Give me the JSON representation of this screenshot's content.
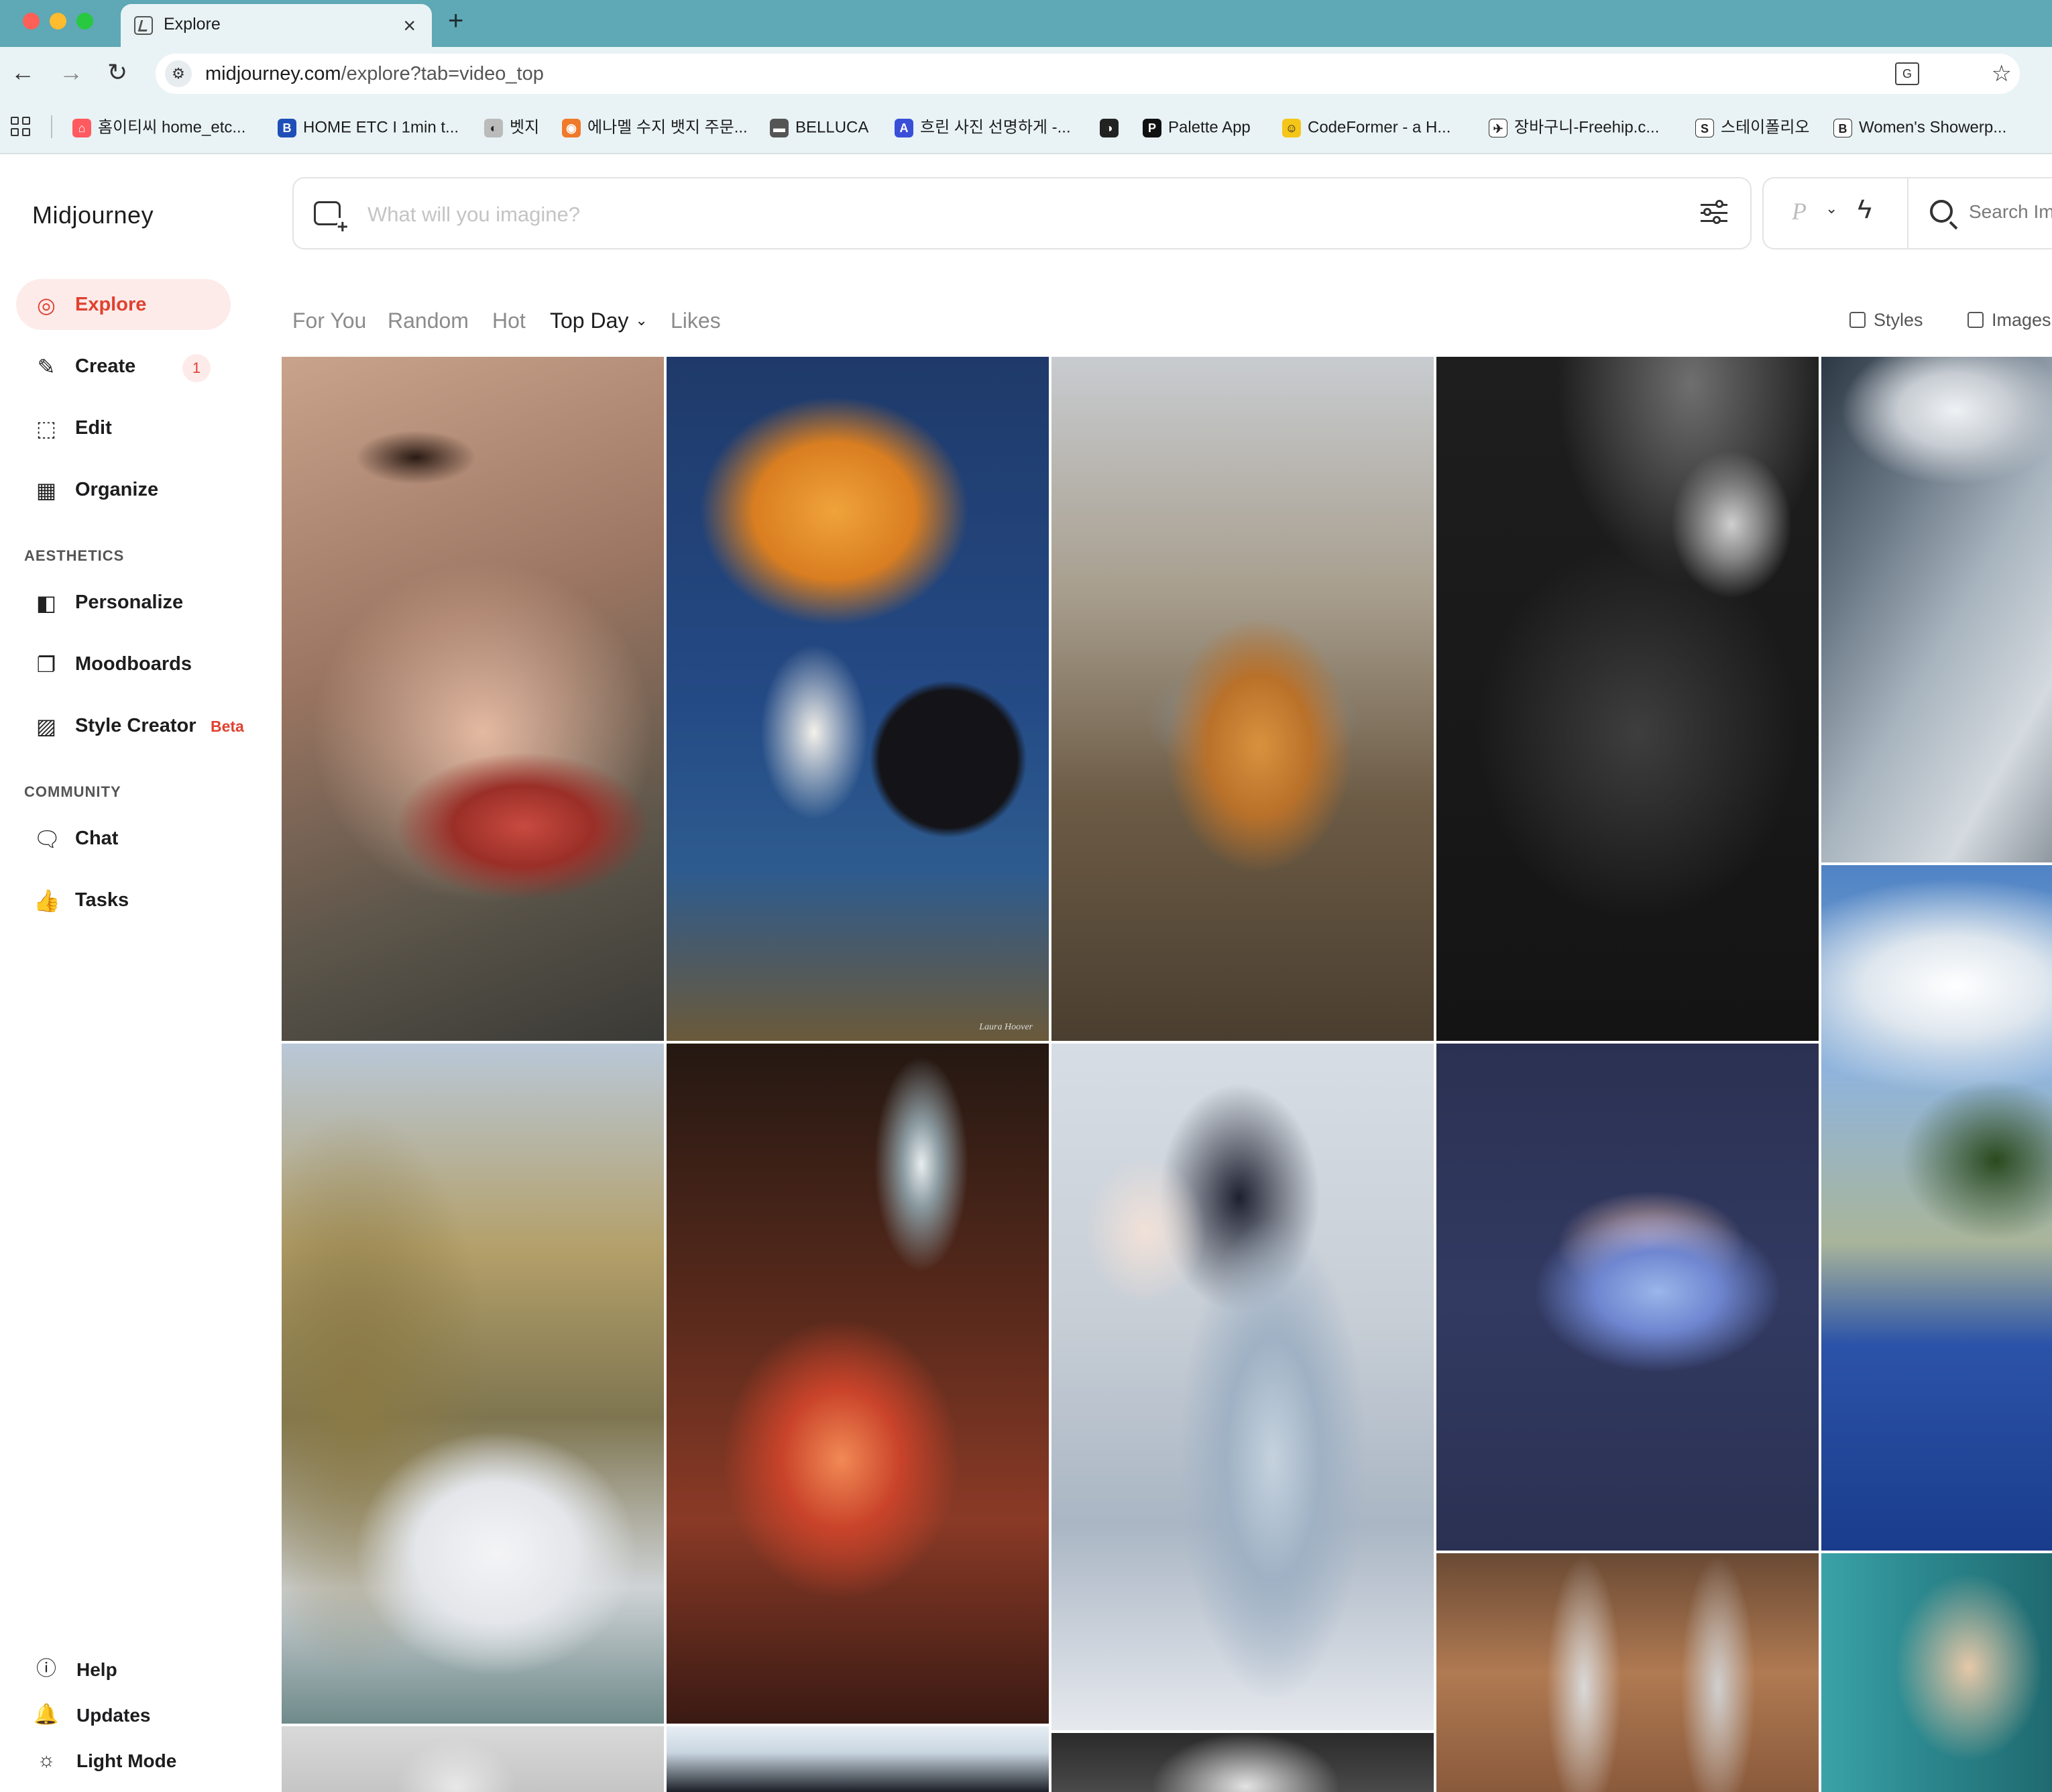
{
  "browser": {
    "tab_title": "Explore",
    "tab_close": "×",
    "new_tab": "+",
    "url_host": "midjourney.com",
    "url_path": "/explore?tab=video_top",
    "bookmarks": [
      {
        "label": "홈이티씨 home_etc...",
        "icon": "airbnb-icon",
        "color": "#ff5a5f",
        "glyph": "⌂"
      },
      {
        "label": "HOME ETC I 1min t...",
        "icon": "b-blue-icon",
        "color": "#1e4fb8",
        "glyph": "B"
      },
      {
        "label": "벳지",
        "icon": "pinwheel-icon",
        "color": "#bbbbbb",
        "glyph": "◐"
      },
      {
        "label": "에나멜 수지 뱃지 주문...",
        "icon": "cat-icon",
        "color": "#f07a2a",
        "glyph": "◉"
      },
      {
        "label": "BELLUCA",
        "icon": "belluca-icon",
        "color": "#555555",
        "glyph": "▬"
      },
      {
        "label": "흐린 사진 선명하게 -...",
        "icon": "a-blue-icon",
        "color": "#3a4fd8",
        "glyph": "A"
      },
      {
        "label": "",
        "icon": "globe-icon",
        "color": "#222222",
        "glyph": "◑"
      },
      {
        "label": "Palette App",
        "icon": "p-black-icon",
        "color": "#111111",
        "glyph": "P"
      },
      {
        "label": "CodeFormer - a H...",
        "icon": "emoji-icon",
        "color": "#f5c518",
        "glyph": "☺"
      },
      {
        "label": "장바구니-Freehip.c...",
        "icon": "freehip-icon",
        "color": "#ffffff",
        "glyph": "✈"
      },
      {
        "label": "스테이폴리오",
        "icon": "s-black-icon",
        "color": "#ffffff",
        "glyph": "S"
      },
      {
        "label": "Women's Showerp...",
        "icon": "b-black-icon",
        "color": "#ffffff",
        "glyph": "B"
      }
    ]
  },
  "sidebar": {
    "brand": "Midjourney",
    "nav": [
      {
        "label": "Explore",
        "icon": "compass-icon",
        "glyph": "⊘"
      },
      {
        "label": "Create",
        "icon": "brush-icon",
        "glyph": "✎",
        "badge": "1"
      },
      {
        "label": "Edit",
        "icon": "edit-icon",
        "glyph": "⬚"
      },
      {
        "label": "Organize",
        "icon": "grid-icon",
        "glyph": "▦"
      }
    ],
    "aesthetics_heading": "AESTHETICS",
    "aesthetics": [
      {
        "label": "Personalize",
        "icon": "personalize-icon",
        "glyph": "◧"
      },
      {
        "label": "Moodboards",
        "icon": "moodboard-icon",
        "glyph": "❐"
      },
      {
        "label": "Style Creator",
        "icon": "style-creator-icon",
        "glyph": "▨",
        "beta": "Beta"
      }
    ],
    "community_heading": "COMMUNITY",
    "community": [
      {
        "label": "Chat",
        "icon": "chat-icon",
        "glyph": "💬"
      },
      {
        "label": "Tasks",
        "icon": "thumbs-up-icon",
        "glyph": "👍"
      }
    ],
    "footer": [
      {
        "label": "Help",
        "icon": "help-icon",
        "glyph": "?"
      },
      {
        "label": "Updates",
        "icon": "bell-icon",
        "glyph": "🔔"
      },
      {
        "label": "Light Mode",
        "icon": "sun-icon",
        "glyph": "☼"
      }
    ]
  },
  "prompt": {
    "placeholder": "What will you imagine?",
    "mode_letter": "P",
    "search_label": "Search Im"
  },
  "filters": {
    "tabs": [
      "For You",
      "Random",
      "Hot",
      "Top Day",
      "Likes"
    ],
    "active": "Top Day",
    "styles_label": "Styles",
    "images_label": "Images"
  },
  "gallery": {
    "signature": "Laura Hoover"
  }
}
